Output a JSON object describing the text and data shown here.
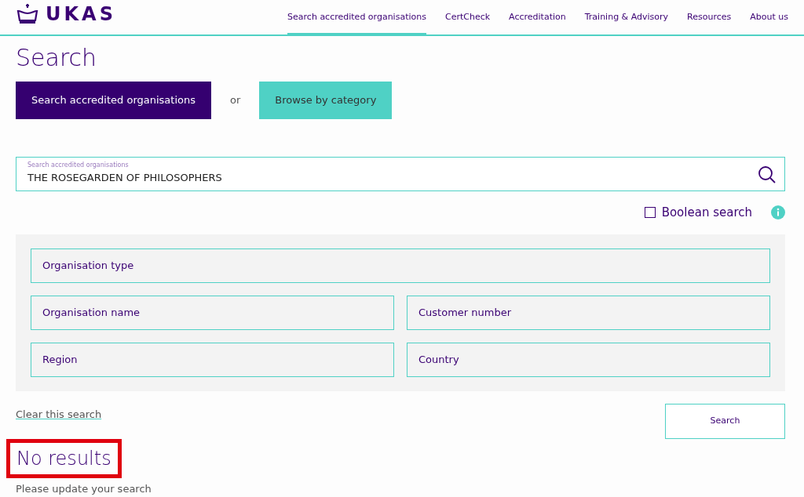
{
  "header": {
    "logo_text": "UKAS",
    "nav": [
      {
        "label": "Search accredited organisations",
        "selected": true
      },
      {
        "label": "CertCheck",
        "selected": false
      },
      {
        "label": "Accreditation",
        "selected": false
      },
      {
        "label": "Training & Advisory",
        "selected": false
      },
      {
        "label": "Resources",
        "selected": false
      },
      {
        "label": "About us",
        "selected": false
      }
    ]
  },
  "title": "Search",
  "mode_buttons": [
    {
      "label": "Search accredited organisations",
      "selected": true
    },
    {
      "label": "Browse by category",
      "selected": false
    }
  ],
  "or_text": "or",
  "search": {
    "label": "Search accredited organisations",
    "value": "THE ROSEGARDEN OF PHILOSOPHERS"
  },
  "boolean_search": {
    "label": "Boolean search",
    "checked": false
  },
  "filters": [
    [
      {
        "placeholder": "Organisation type"
      }
    ],
    [
      {
        "placeholder": "Organisation name"
      },
      {
        "placeholder": "Customer number"
      }
    ],
    [
      {
        "placeholder": "Region"
      },
      {
        "placeholder": "Country"
      }
    ]
  ],
  "clear_link": "Clear this search",
  "search_button": "Search",
  "results": {
    "heading": "No results",
    "highlighted": true,
    "message": "Please update your search"
  }
}
